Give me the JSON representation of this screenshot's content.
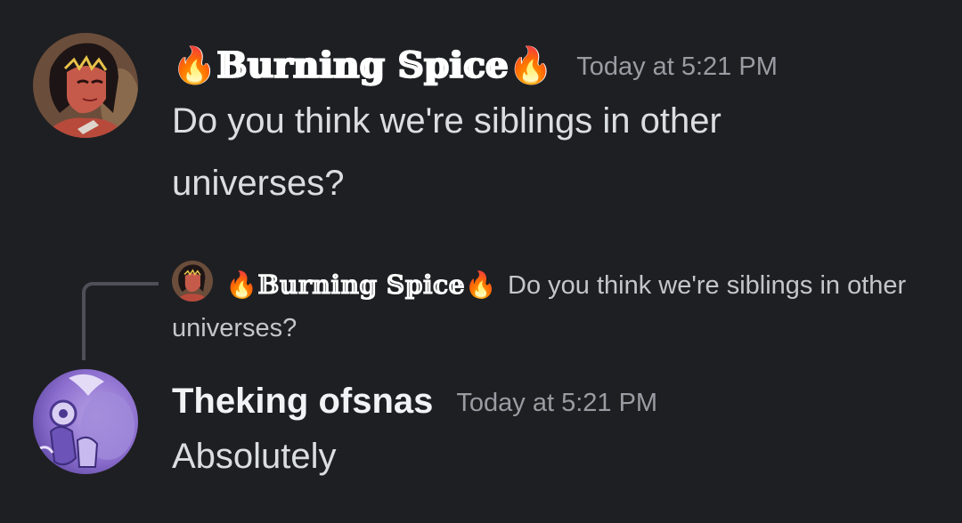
{
  "messages": [
    {
      "author": "🔥𝔹𝕦𝕣𝕟𝕚𝕟𝕘 𝕊𝕡𝕚𝕔𝕖🔥",
      "timestamp": "Today at 5:21 PM",
      "text": "Do you think we're siblings in other universes?",
      "avatar_icon": "user-avatar-red-character"
    },
    {
      "author": "Theking ofsnas",
      "timestamp": "Today at 5:21 PM",
      "text": "Absolutely",
      "avatar_icon": "user-avatar-purple-character",
      "reply_to": {
        "author": "🔥𝔹𝕦𝕣𝕟𝕚𝕟𝕘 𝕊𝕡𝕚𝕔𝕖🔥",
        "text": "Do you think we're siblings in other universes?",
        "avatar_icon": "user-avatar-red-character"
      }
    }
  ],
  "colors": {
    "background": "#1e1f22",
    "message_text": "#dbdee1",
    "timestamp": "#9b9ca3",
    "reply_line": "#4e5058"
  }
}
